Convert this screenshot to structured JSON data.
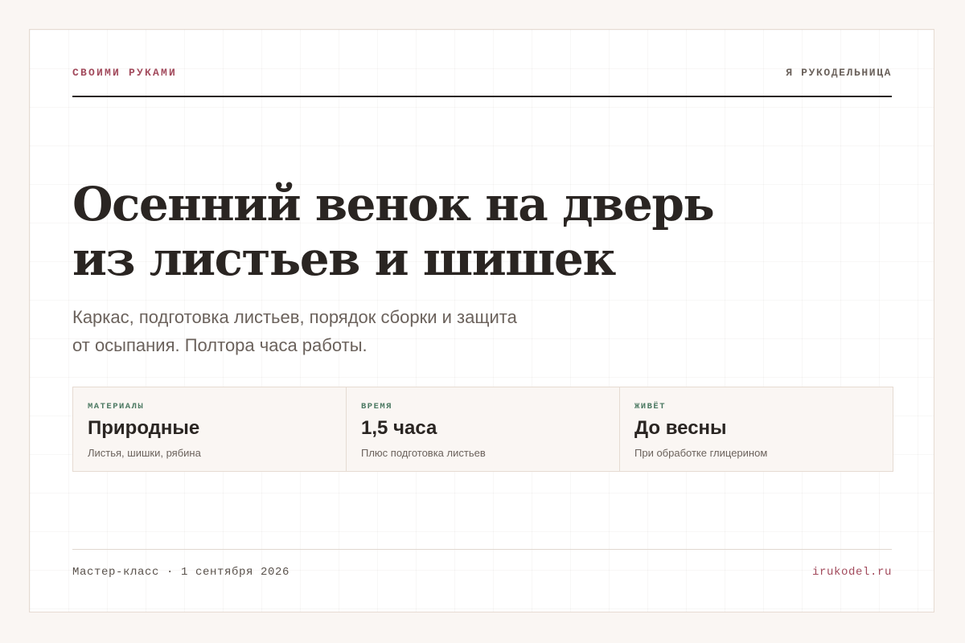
{
  "header": {
    "brand": "СВОИМИ РУКАМИ",
    "site_name": "Я РУКОДЕЛЬНИЦА"
  },
  "article": {
    "title_lines": [
      "Осенний венок на дверь",
      "из листьев и шишек"
    ],
    "subtitle_lines": [
      "Каркас, подготовка листьев, порядок сборки и защита",
      "от осыпания. Полтора часа работы."
    ]
  },
  "stats": [
    {
      "label": "МАТЕРИАЛЫ",
      "value": "Природные",
      "note": "Листья, шишки, рябина"
    },
    {
      "label": "ВРЕМЯ",
      "value": "1,5 часа",
      "note": "Плюс подготовка листьев"
    },
    {
      "label": "ЖИВЁТ",
      "value": "До весны",
      "note": "При обработке глицерином"
    }
  ],
  "footer": {
    "meta": "Мастер-класс · 1 сентября 2026",
    "domain": "irukodel.ru"
  },
  "colors": {
    "accent": "#a24a5c",
    "label_green": "#4d7a63",
    "text_dark": "#2a2522",
    "text_muted": "#6b625c",
    "page_bg": "#faf6f3",
    "border": "#e6dbd2"
  }
}
